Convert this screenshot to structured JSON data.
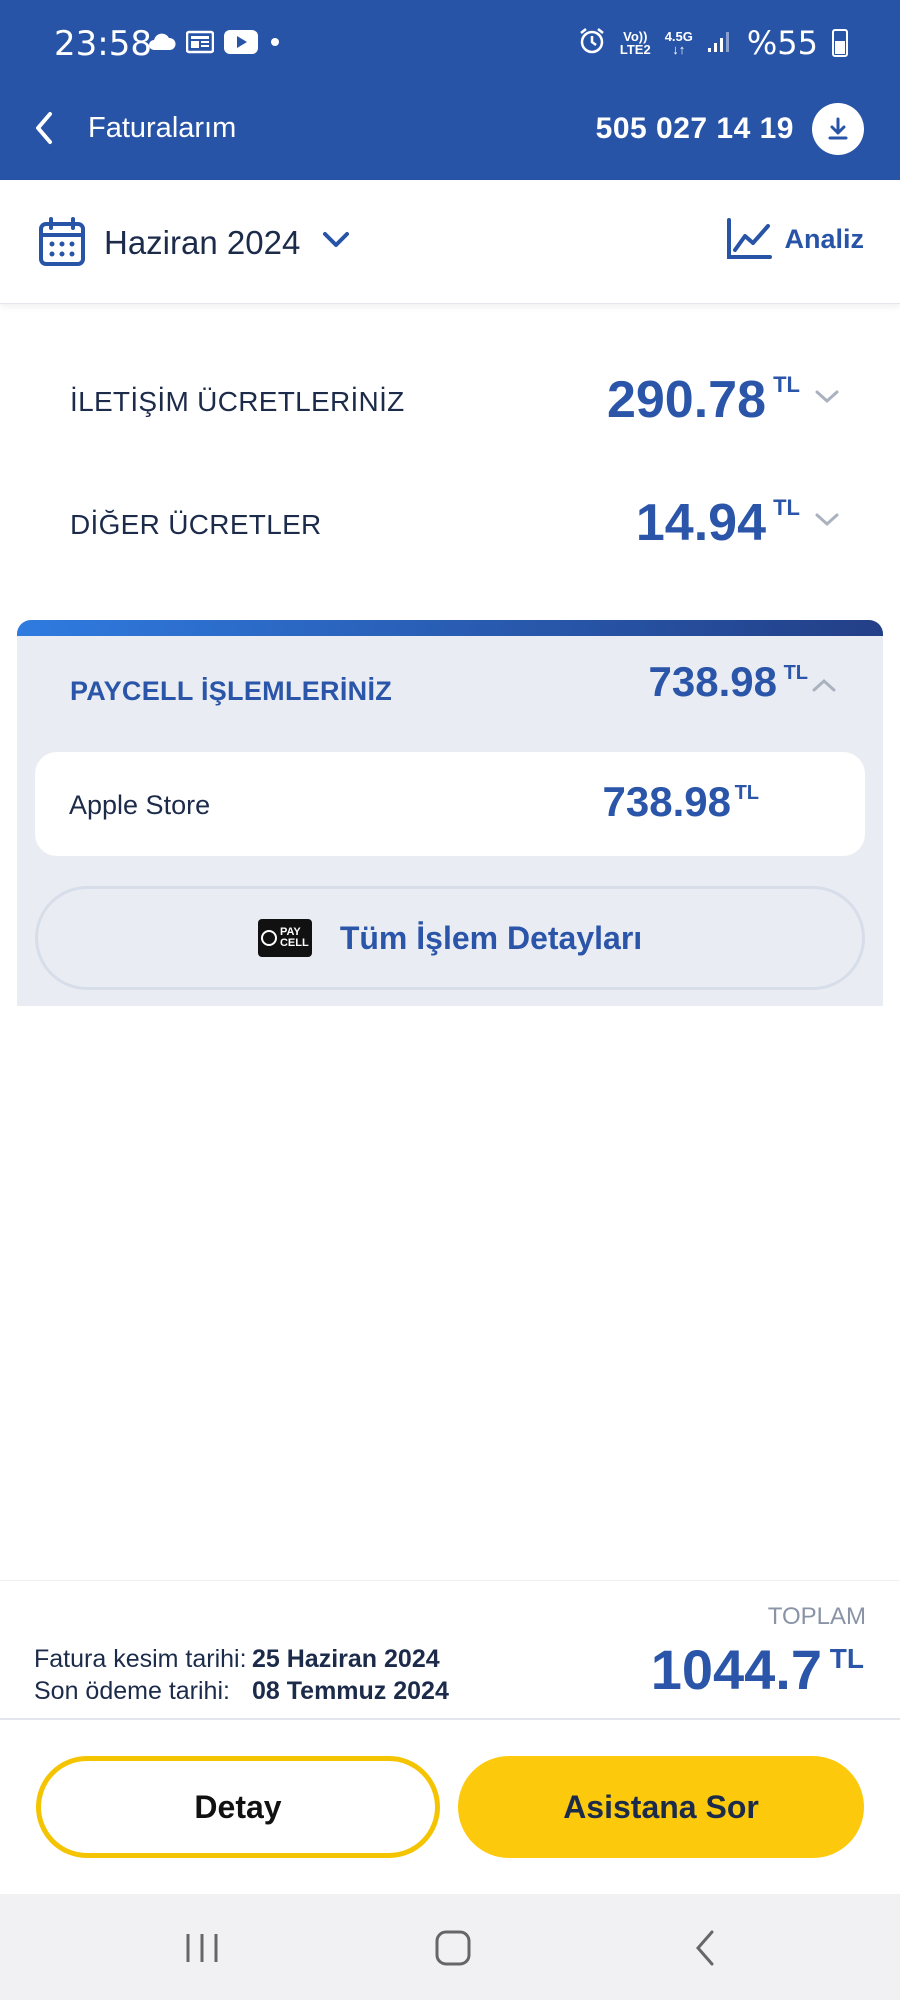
{
  "status_bar": {
    "time": "23:58",
    "left_icons": [
      "cloud-icon",
      "news-icon",
      "youtube-icon",
      "dot-icon"
    ],
    "network_top": "Vo))",
    "network_bottom": "LTE2",
    "network_gen": "4.5G",
    "battery": "%55"
  },
  "header": {
    "title": "Faturalarım",
    "phone": "505 027 14 19"
  },
  "period": {
    "month": "Haziran 2024",
    "analysis_label": "Analiz"
  },
  "charges": [
    {
      "label": "İLETİŞİM ÜCRETLERİNİZ",
      "amount": "290.78",
      "unit": "TL"
    },
    {
      "label": "DİĞER ÜCRETLER",
      "amount": "14.94",
      "unit": "TL"
    }
  ],
  "paycell": {
    "title": "PAYCELL İŞLEMLERİNİZ",
    "amount": "738.98",
    "unit": "TL",
    "items": [
      {
        "label": "Apple Store",
        "amount": "738.98",
        "unit": "TL"
      }
    ],
    "logo_text_top": "PAY",
    "logo_text_bottom": "CELL",
    "details_label": "Tüm İşlem Detayları"
  },
  "summary": {
    "cut_date_label": "Fatura kesim tarihi:",
    "cut_date": "25 Haziran 2024",
    "due_date_label": "Son ödeme tarihi:",
    "due_date": "08 Temmuz 2024",
    "total_label": "TOPLAM",
    "total": "1044.7",
    "unit": "TL"
  },
  "actions": {
    "detail_label": "Detay",
    "assistant_label": "Asistana Sor"
  },
  "colors": {
    "brand_blue": "#2854a8",
    "accent_yellow": "#fdc90c"
  }
}
